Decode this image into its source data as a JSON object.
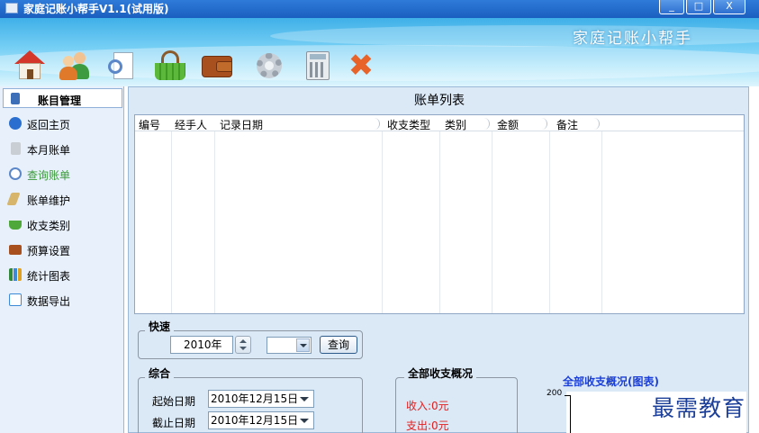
{
  "window": {
    "title": "家庭记账小帮手V1.1(试用版)",
    "min_label": "_",
    "max_label": "□",
    "close_label": "X"
  },
  "banner": {
    "brand": "家庭记账小帮手",
    "toolbar_icons": [
      "home-icon",
      "users-icon",
      "search-icon",
      "basket-icon",
      "wallet-icon",
      "gear-icon",
      "calculator-icon",
      "exit-icon"
    ],
    "exit_glyph": "✖"
  },
  "sidebar": {
    "header": "账目管理",
    "active_color": "#3a9a3a",
    "items": [
      {
        "label": "返回主页",
        "icon": "back-arrow-icon",
        "color": "#2a6fd0"
      },
      {
        "label": "本月账单",
        "icon": "document-icon",
        "color": "#c9ced4"
      },
      {
        "label": "查询账单",
        "icon": "search-icon",
        "color": "#5b87c9"
      },
      {
        "label": "账单维护",
        "icon": "edit-icon",
        "color": "#d7b56a"
      },
      {
        "label": "收支类别",
        "icon": "basket-icon",
        "color": "#4ea83a"
      },
      {
        "label": "预算设置",
        "icon": "wallet-icon",
        "color": "#a8501e"
      },
      {
        "label": "统计图表",
        "icon": "bar-chart-icon",
        "color": "#2f8a3a"
      },
      {
        "label": "数据导出",
        "icon": "export-icon",
        "color": "#3a8ad8"
      }
    ]
  },
  "main": {
    "list_title": "账单列表",
    "columns": [
      "编号",
      "经手人",
      "记录日期",
      "收支类型",
      "类别",
      "金额",
      "备注"
    ],
    "rows": []
  },
  "quick": {
    "title": "快速",
    "year_value": "2010年",
    "month_value": "",
    "query_label": "查询"
  },
  "combined": {
    "title": "综合",
    "start_label": "起始日期",
    "start_value": "2010年12月15日",
    "end_label": "截止日期",
    "end_value": "2010年12月15日"
  },
  "summary": {
    "title": "全部收支概况",
    "income": "收入:0元",
    "expense": "支出:0元"
  },
  "chart": {
    "title": "全部收支概况(图表)",
    "y_top_label": "200"
  },
  "watermark": "最需教育"
}
